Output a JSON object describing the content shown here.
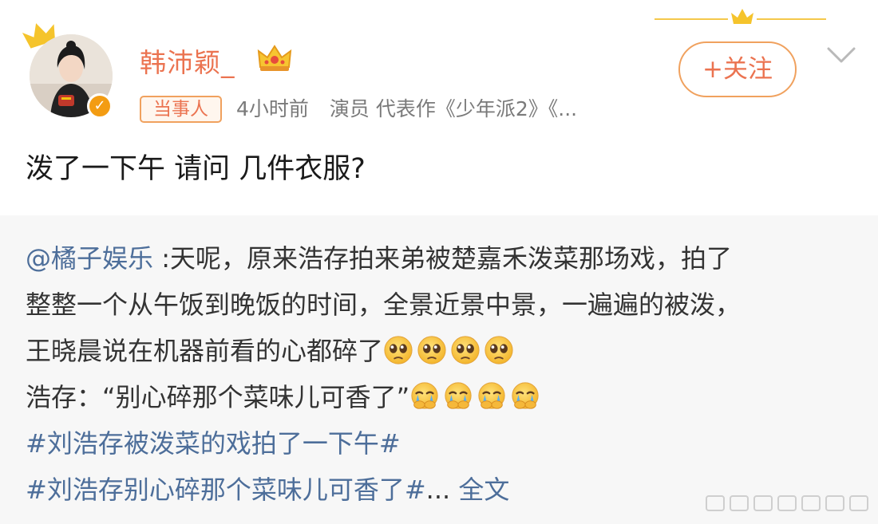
{
  "author": {
    "name": "韩沛颖_",
    "verified_icon": "verified-v-icon",
    "crown_icon": "crown-icon"
  },
  "follow_button": {
    "plus": "+",
    "label": "关注"
  },
  "meta": {
    "tag": "当事人",
    "time": "4小时前",
    "role": "演员 代表作《少年派2》《..."
  },
  "post": {
    "text": "泼了一下午 请问 几件衣服?"
  },
  "repost": {
    "mention": "@橘子娱乐",
    "line1_text": " :天呢，原来浩存拍来弟被楚嘉禾泼菜那场戏，拍了",
    "line2_text": "整整一个从午饭到晚饭的时间，全景近景中景，一遍遍的被泼，",
    "line3_text": "王晓晨说在机器前看的心都碎了",
    "line4_text": "浩存：“别心碎那个菜味儿可香了”",
    "hashtag1": "#刘浩存被泼菜的戏拍了一下午#",
    "hashtag2": "#刘浩存别心碎那个菜味儿可香了#",
    "ellipsis": "...",
    "more_link": "全文"
  },
  "emojis": {
    "line3": [
      "teary-eyes-emoji",
      "teary-eyes-emoji",
      "teary-eyes-emoji",
      "teary-eyes-emoji"
    ],
    "line4": [
      "crying-covering-mouth-emoji",
      "crying-covering-mouth-emoji",
      "crying-covering-mouth-emoji",
      "crying-covering-mouth-emoji"
    ]
  },
  "colors": {
    "accent": "#eb7350",
    "link": "#4d6e9a",
    "repost_bg": "#f7f7f7",
    "meta_gray": "#7a7a7a"
  }
}
